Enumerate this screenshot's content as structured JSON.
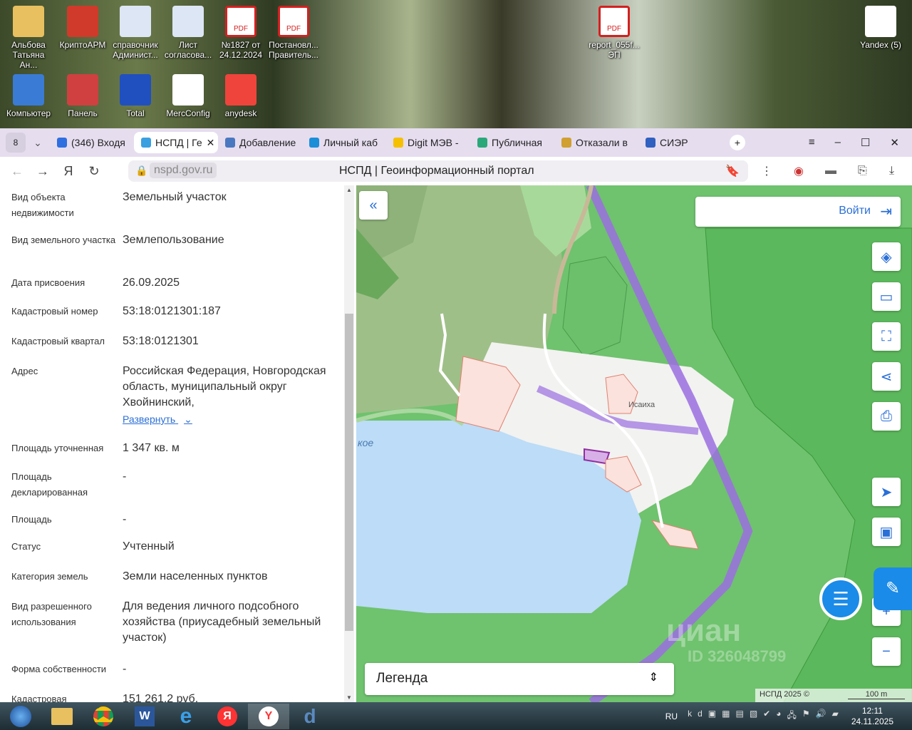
{
  "desktop": {
    "icons": [
      {
        "label": "Альбова Татьяна Ан...",
        "color": "#e8c060"
      },
      {
        "label": "КриптоАРМ",
        "color": "#d03a2a"
      },
      {
        "label": "справочник Админист...",
        "color": "#dde6f4"
      },
      {
        "label": "Лист согласова...",
        "color": "#dde6f4"
      },
      {
        "label": "№1827 от 24.12.2024",
        "color": "#ffffff",
        "badge": "PDF"
      },
      {
        "label": "Постановл... Правитель...",
        "color": "#ffffff",
        "badge": "PDF"
      },
      {
        "label": "report_055f... ЭП",
        "color": "#ffffff",
        "badge": "PDF"
      },
      {
        "label": "Yandex (5)",
        "color": "#ffffff"
      },
      {
        "label": "Компьютер",
        "color": "#3a7bd5"
      },
      {
        "label": "Панель",
        "color": "#d04040"
      },
      {
        "label": "Total",
        "color": "#2050c0"
      },
      {
        "label": "MercConfig",
        "color": "#ffffff"
      },
      {
        "label": "anydesk",
        "color": "#ef443b"
      }
    ]
  },
  "browser": {
    "tab_count": "8",
    "tabs": [
      {
        "label": "(346) Входя",
        "color": "#2f6fe0"
      },
      {
        "label": "НСПД | Ге",
        "color": "#3aa0e0",
        "active": true
      },
      {
        "label": "Добавление",
        "color": "#4a78c0"
      },
      {
        "label": "Личный каб",
        "color": "#1b8ed8"
      },
      {
        "label": "Digit МЭВ -",
        "color": "#f5c000"
      },
      {
        "label": "Публичная",
        "color": "#2aa87a"
      },
      {
        "label": "Отказали в",
        "color": "#d0a030"
      },
      {
        "label": "СИЭР",
        "color": "#3060c0"
      }
    ],
    "url": "nspd.gov.ru",
    "page_title": "НСПД | Геоинформационный портал"
  },
  "details": [
    {
      "k": "Вид объекта недвижимости",
      "v": "Земельный участок"
    },
    {
      "k": "Вид земельного участка",
      "v": "Землепользование"
    },
    {
      "k": "Дата присвоения",
      "v": "26.09.2025"
    },
    {
      "k": "Кадастровый номер",
      "v": "53:18:0121301:187"
    },
    {
      "k": "Кадастровый квартал",
      "v": "53:18:0121301"
    },
    {
      "k": "Адрес",
      "v": "Российская Федерация, Новгородская область, муниципальный округ Хвойнинский,"
    },
    {
      "k": "Площадь уточненная",
      "v": "1 347 кв. м"
    },
    {
      "k": "Площадь декларированная",
      "v": "-"
    },
    {
      "k": "Площадь",
      "v": "-"
    },
    {
      "k": "Статус",
      "v": "Учтенный"
    },
    {
      "k": "Категория земель",
      "v": "Земли населенных пунктов"
    },
    {
      "k": "Вид разрешенного использования",
      "v": "Для ведения личного подсобного хозяйства (приусадебный земельный участок)"
    },
    {
      "k": "Форма собственности",
      "v": "-"
    },
    {
      "k": "Кадастровая",
      "v": "151 261,2 руб."
    }
  ],
  "expand_label": "Развернуть",
  "map": {
    "login": "Войти",
    "legend": "Легенда",
    "village": "Исаиха",
    "lake_label": "кое",
    "copyright": "НСПД 2025 ©",
    "scale": "100 m",
    "watermark": "циан",
    "watermark_id": "ID 326048799"
  },
  "taskbar": {
    "lang": "RU",
    "time": "12:11",
    "date": "24.11.2025"
  }
}
